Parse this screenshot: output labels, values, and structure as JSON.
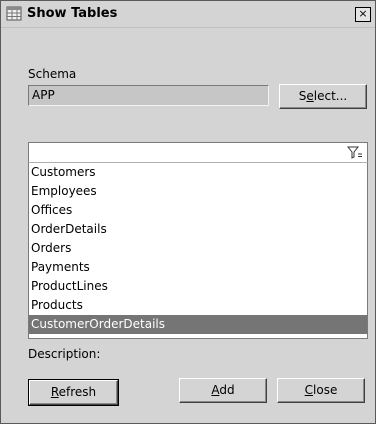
{
  "window": {
    "title": "Show Tables",
    "close_glyph": "×",
    "icon": "table-icon"
  },
  "schema": {
    "label": "Schema",
    "value": "APP",
    "select_label_pre": "S",
    "select_label_u": "e",
    "select_label_post": "lect..."
  },
  "filter": {
    "value": "",
    "icon": "filter-icon"
  },
  "tables": [
    {
      "name": "Customers",
      "selected": false
    },
    {
      "name": "Employees",
      "selected": false
    },
    {
      "name": "Offices",
      "selected": false
    },
    {
      "name": "OrderDetails",
      "selected": false
    },
    {
      "name": "Orders",
      "selected": false
    },
    {
      "name": "Payments",
      "selected": false
    },
    {
      "name": "ProductLines",
      "selected": false
    },
    {
      "name": "Products",
      "selected": false
    },
    {
      "name": "CustomerOrderDetails",
      "selected": true
    }
  ],
  "description": {
    "label": "Description:"
  },
  "buttons": {
    "refresh_u": "R",
    "refresh_rest": "efresh",
    "add_u": "A",
    "add_rest": "dd",
    "close_u": "C",
    "close_rest": "lose"
  }
}
